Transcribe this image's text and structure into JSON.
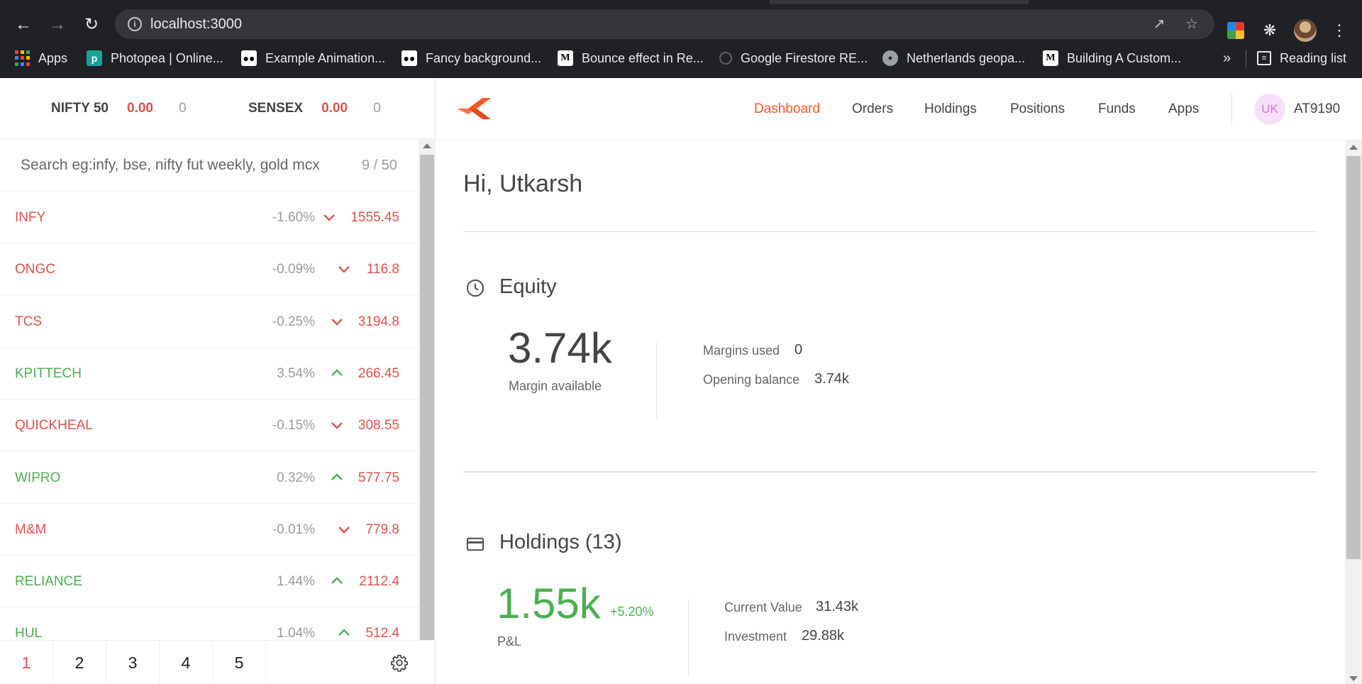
{
  "browser": {
    "url": "localhost:3000",
    "bookmarks": [
      {
        "label": "Apps",
        "icon": "apps-grid-icon"
      },
      {
        "label": "Photopea | Online...",
        "icon": "photopea-icon"
      },
      {
        "label": "Example Animation...",
        "icon": "medium-icon"
      },
      {
        "label": "Fancy background...",
        "icon": "medium-icon"
      },
      {
        "label": "Bounce effect in Re...",
        "icon": "medium-m-icon"
      },
      {
        "label": "Google Firestore RE...",
        "icon": "globe-icon"
      },
      {
        "label": "Netherlands geopa...",
        "icon": "globe-icon"
      },
      {
        "label": "Building A Custom...",
        "icon": "medium-m-icon"
      }
    ],
    "more_bookmarks": "»",
    "reading_list": "Reading list"
  },
  "indices": [
    {
      "name": "NIFTY 50",
      "value": "0.00",
      "change": "0"
    },
    {
      "name": "SENSEX",
      "value": "0.00",
      "change": "0"
    }
  ],
  "search": {
    "placeholder": "Search eg:infy, bse, nifty fut weekly, gold mcx",
    "count": "9 / 50"
  },
  "watchlist": [
    {
      "symbol": "INFY",
      "change": "-1.60%",
      "direction": "down",
      "price": "1555.45"
    },
    {
      "symbol": "ONGC",
      "change": "-0.09%",
      "direction": "down",
      "price": "116.8"
    },
    {
      "symbol": "TCS",
      "change": "-0.25%",
      "direction": "down",
      "price": "3194.8"
    },
    {
      "symbol": "KPITTECH",
      "change": "3.54%",
      "direction": "up",
      "price": "266.45"
    },
    {
      "symbol": "QUICKHEAL",
      "change": "-0.15%",
      "direction": "down",
      "price": "308.55"
    },
    {
      "symbol": "WIPRO",
      "change": "0.32%",
      "direction": "up",
      "price": "577.75"
    },
    {
      "symbol": "M&M",
      "change": "-0.01%",
      "direction": "down",
      "price": "779.8"
    },
    {
      "symbol": "RELIANCE",
      "change": "1.44%",
      "direction": "up",
      "price": "2112.4"
    },
    {
      "symbol": "HUL",
      "change": "1.04%",
      "direction": "up",
      "price": "512.4"
    }
  ],
  "pager": {
    "pages": [
      "1",
      "2",
      "3",
      "4",
      "5"
    ],
    "active": "1"
  },
  "nav": {
    "items": [
      "Dashboard",
      "Orders",
      "Holdings",
      "Positions",
      "Funds",
      "Apps"
    ],
    "active": "Dashboard",
    "user_initials": "UK",
    "user_id": "AT9190"
  },
  "dashboard": {
    "greeting": "Hi, Utkarsh",
    "equity": {
      "title": "Equity",
      "margin_available": "3.74k",
      "margin_available_label": "Margin available",
      "margins_used_label": "Margins used",
      "margins_used": "0",
      "opening_balance_label": "Opening balance",
      "opening_balance": "3.74k"
    },
    "holdings": {
      "title": "Holdings (13)",
      "pnl": "1.55k",
      "pnl_pct": "+5.20%",
      "pnl_label": "P&L",
      "current_value_label": "Current Value",
      "current_value": "31.43k",
      "investment_label": "Investment",
      "investment": "29.88k"
    }
  },
  "colors": {
    "accent": "#ff5722",
    "down": "#df514c",
    "up": "#4caf50",
    "avatar_bg": "#f6e0f9"
  }
}
